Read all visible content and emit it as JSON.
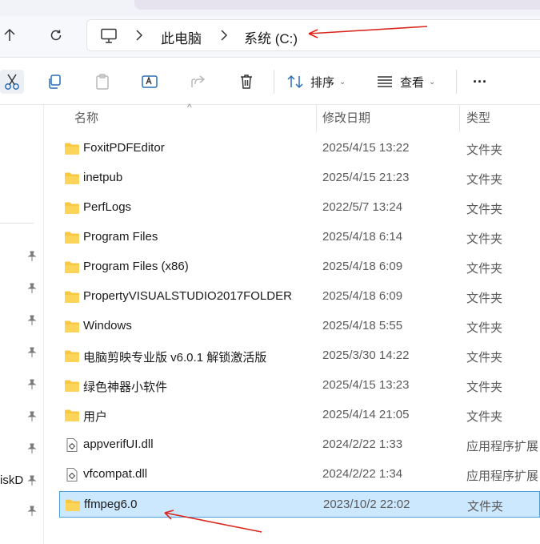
{
  "breadcrumb": {
    "root_icon": "computer-icon",
    "items": [
      "此电脑",
      "系统 (C:)"
    ]
  },
  "toolbar": {
    "sort_label": "排序",
    "view_label": "查看",
    "more_label": "···"
  },
  "columns": {
    "name": "名称",
    "modified": "修改日期",
    "type": "类型"
  },
  "sidebar": {
    "partial_label": "iskD"
  },
  "files": [
    {
      "name": "FoxitPDFEditor",
      "modified": "2025/4/15 13:22",
      "type": "文件夹",
      "icon": "folder-icon"
    },
    {
      "name": "inetpub",
      "modified": "2025/4/15 21:23",
      "type": "文件夹",
      "icon": "folder-icon"
    },
    {
      "name": "PerfLogs",
      "modified": "2022/5/7 13:24",
      "type": "文件夹",
      "icon": "folder-icon"
    },
    {
      "name": "Program Files",
      "modified": "2025/4/18 6:14",
      "type": "文件夹",
      "icon": "folder-icon"
    },
    {
      "name": "Program Files (x86)",
      "modified": "2025/4/18 6:09",
      "type": "文件夹",
      "icon": "folder-icon"
    },
    {
      "name": "PropertyVISUALSTUDIO2017FOLDER",
      "modified": "2025/4/18 6:09",
      "type": "文件夹",
      "icon": "folder-icon"
    },
    {
      "name": "Windows",
      "modified": "2025/4/18 5:55",
      "type": "文件夹",
      "icon": "folder-icon"
    },
    {
      "name": "电脑剪映专业版 v6.0.1 解锁激活版",
      "modified": "2025/3/30 14:22",
      "type": "文件夹",
      "icon": "folder-icon"
    },
    {
      "name": "绿色神器小软件",
      "modified": "2025/4/15 13:23",
      "type": "文件夹",
      "icon": "folder-icon"
    },
    {
      "name": "用户",
      "modified": "2025/4/14 21:05",
      "type": "文件夹",
      "icon": "folder-icon"
    },
    {
      "name": "appverifUI.dll",
      "modified": "2024/2/22 1:33",
      "type": "应用程序扩展",
      "icon": "dll-file-icon"
    },
    {
      "name": "vfcompat.dll",
      "modified": "2024/2/22 1:34",
      "type": "应用程序扩展",
      "icon": "dll-file-icon"
    },
    {
      "name": "ffmpeg6.0",
      "modified": "2023/10/2 22:02",
      "type": "文件夹",
      "icon": "folder-icon",
      "selected": true
    }
  ],
  "colors": {
    "selection_fill": "#cce8ff",
    "selection_border": "#4a9ede",
    "folder_yellow": "#f8c843",
    "annotation_red": "#d9261c"
  }
}
